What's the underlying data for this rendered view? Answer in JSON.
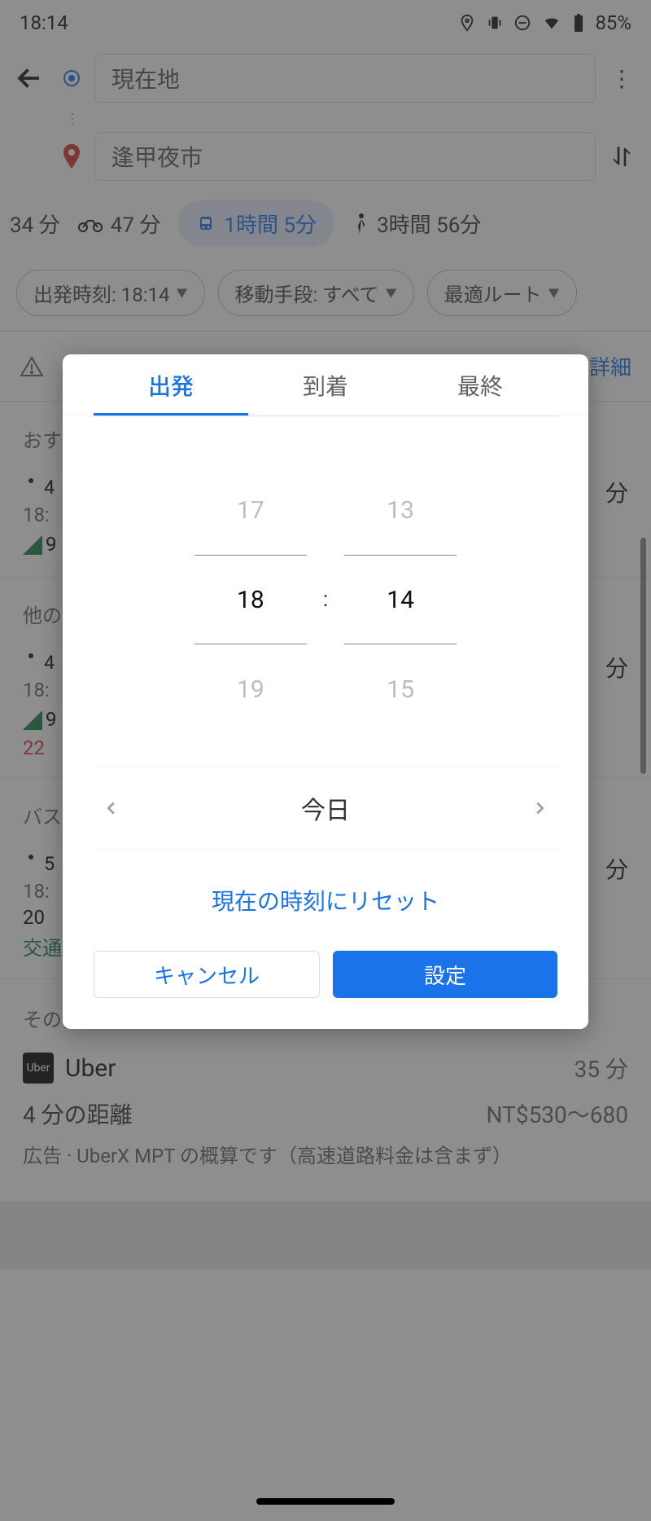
{
  "status": {
    "time": "18:14",
    "battery": "85%"
  },
  "header": {
    "origin": "現在地",
    "destination": "逢甲夜市"
  },
  "modes": {
    "drive": "34 分",
    "motorcycle": "47 分",
    "transit": "1時間 5分",
    "walk": "3時間 56分"
  },
  "chips": {
    "depart": "出発時刻: 18:14",
    "vehicle": "移動手段: すべて",
    "route": "最適ルート"
  },
  "alert": {
    "details": "詳細"
  },
  "sections": {
    "recommend": "おすすめのルート",
    "other_routes": "他のルート",
    "bus": "バス",
    "other": "その他"
  },
  "routes": [
    {
      "icons_walk_min": "4",
      "time": "18:",
      "sig": "9",
      "mins": "分"
    },
    {
      "icons_walk_min": "4",
      "time": "18:",
      "sig": "9",
      "extra": "22",
      "mins": "分"
    },
    {
      "icons_walk_min": "5",
      "time": "18:",
      "note_min": "20",
      "note": "交通",
      "mins": "分"
    }
  ],
  "uber": {
    "name": "Uber",
    "duration": "35 分",
    "distance": "4 分の距離",
    "price": "NT$530～680",
    "adnote": "広告 · UberX MPT の概算です（高速道路料金は含まず）"
  },
  "dialog": {
    "tabs": {
      "depart": "出発",
      "arrive": "到着",
      "last": "最終"
    },
    "hours": {
      "prev": "17",
      "cur": "18",
      "next": "19"
    },
    "mins": {
      "prev": "13",
      "cur": "14",
      "next": "15"
    },
    "colon": ":",
    "date": "今日",
    "reset": "現在の時刻にリセット",
    "cancel": "キャンセル",
    "set": "設定"
  }
}
